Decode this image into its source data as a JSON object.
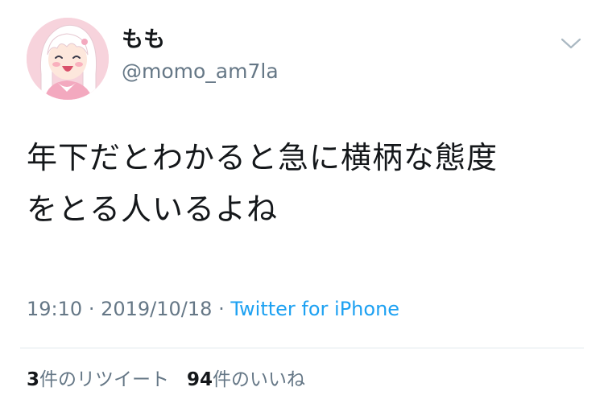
{
  "user": {
    "display_name": "もも",
    "handle": "@momo_am7la"
  },
  "tweet": {
    "lines": [
      "年下だとわかると急に横柄な態度",
      "をとる人いるよね"
    ]
  },
  "meta": {
    "time": "19:10",
    "separator": "·",
    "date": "2019/10/18",
    "source": "Twitter for iPhone"
  },
  "stats": {
    "retweets_count": "3",
    "retweets_label": "件のリツイート",
    "likes_count": "94",
    "likes_label": "件のいいね"
  },
  "icons": {
    "caret": "chevron-down-icon",
    "avatar": "anime-girl-avatar"
  },
  "colors": {
    "text_primary": "#14171a",
    "text_secondary": "#657786",
    "link": "#1da1f2",
    "divider": "#e1e8ed",
    "avatar_bg": "#f7d3dc"
  }
}
